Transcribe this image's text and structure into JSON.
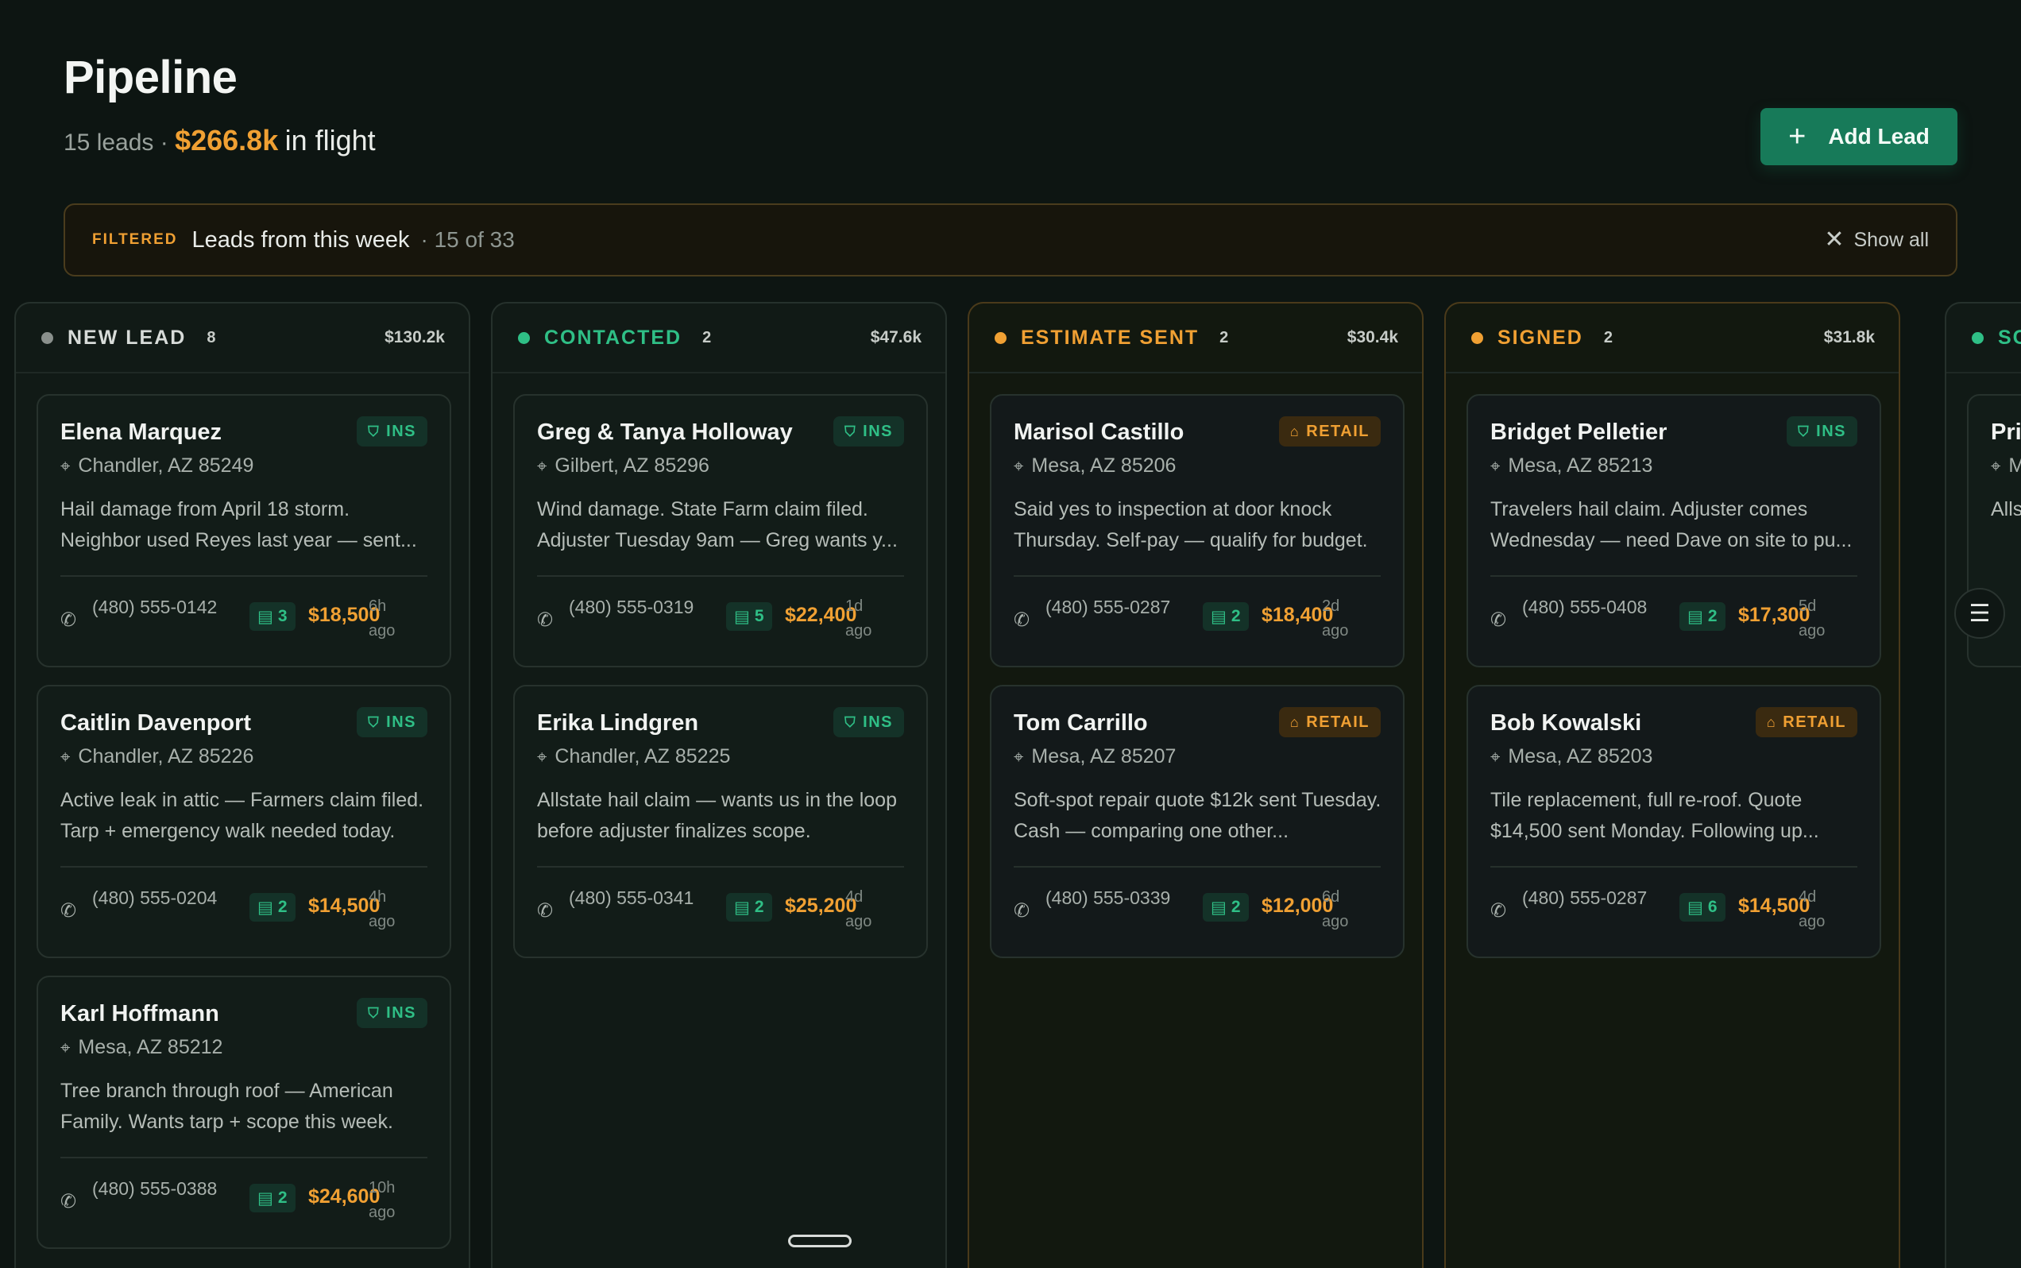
{
  "header": {
    "title": "Pipeline",
    "lead_count": "15 leads ·",
    "amount": "$266.8k",
    "amount_suffix": "in flight",
    "add_button": "Add Lead"
  },
  "filter": {
    "tag": "FILTERED",
    "label": "Leads from this week",
    "count": "· 15 of 33",
    "show_all": "Show all"
  },
  "colors": {
    "accent_green": "#177a59",
    "ins_green": "#2fbf86",
    "amber": "#f0a033",
    "new_lead_dot": "#8a908c"
  },
  "columns": [
    {
      "title": "NEW LEAD",
      "count": "8",
      "total": "$130.2k",
      "cards": [
        {
          "name": "Elena Marquez",
          "badge": "INS",
          "location": "Chandler, AZ 85249",
          "note": "Hail damage from April 18 storm. Neighbor used Reyes last year — sent...",
          "phone": "(480) 555-0142",
          "notes": "3",
          "price": "$18,500",
          "ago": "6h ago"
        },
        {
          "name": "Caitlin Davenport",
          "badge": "INS",
          "location": "Chandler, AZ 85226",
          "note": "Active leak in attic — Farmers claim filed. Tarp + emergency walk needed today.",
          "phone": "(480) 555-0204",
          "notes": "2",
          "price": "$14,500",
          "ago": "4h ago"
        },
        {
          "name": "Karl Hoffmann",
          "badge": "INS",
          "location": "Mesa, AZ 85212",
          "note": "Tree branch through roof — American Family. Wants tarp + scope this week.",
          "phone": "(480) 555-0388",
          "notes": "2",
          "price": "$24,600",
          "ago": "10h ago"
        }
      ]
    },
    {
      "title": "CONTACTED",
      "count": "2",
      "total": "$47.6k",
      "cards": [
        {
          "name": "Greg & Tanya Holloway",
          "badge": "INS",
          "location": "Gilbert, AZ 85296",
          "note": "Wind damage. State Farm claim filed. Adjuster Tuesday 9am — Greg wants y...",
          "phone": "(480) 555-0319",
          "notes": "5",
          "price": "$22,400",
          "ago": "1d ago"
        },
        {
          "name": "Erika Lindgren",
          "badge": "INS",
          "location": "Chandler, AZ 85225",
          "note": "Allstate hail claim — wants us in the loop before adjuster finalizes scope.",
          "phone": "(480) 555-0341",
          "notes": "2",
          "price": "$25,200",
          "ago": "4d ago"
        }
      ]
    },
    {
      "title": "ESTIMATE SENT",
      "count": "2",
      "total": "$30.4k",
      "cards": [
        {
          "name": "Marisol Castillo",
          "badge": "RETAIL",
          "location": "Mesa, AZ 85206",
          "note": "Said yes to inspection at door knock Thursday. Self-pay — qualify for budget.",
          "phone": "(480) 555-0287",
          "notes": "2",
          "price": "$18,400",
          "ago": "2d ago"
        },
        {
          "name": "Tom Carrillo",
          "badge": "RETAIL",
          "location": "Mesa, AZ 85207",
          "note": "Soft-spot repair quote $12k sent Tuesday. Cash — comparing one other...",
          "phone": "(480) 555-0339",
          "notes": "2",
          "price": "$12,000",
          "ago": "6d ago"
        }
      ]
    },
    {
      "title": "SIGNED",
      "count": "2",
      "total": "$31.8k",
      "cards": [
        {
          "name": "Bridget Pelletier",
          "badge": "INS",
          "location": "Mesa, AZ 85213",
          "note": "Travelers hail claim. Adjuster comes Wednesday — need Dave on site to pu...",
          "phone": "(480) 555-0408",
          "notes": "2",
          "price": "$17,300",
          "ago": "5d ago"
        },
        {
          "name": "Bob Kowalski",
          "badge": "RETAIL",
          "location": "Mesa, AZ 85203",
          "note": "Tile replacement, full re-roof. Quote $14,500 sent Monday. Following up...",
          "phone": "(480) 555-0287",
          "notes": "6",
          "price": "$14,500",
          "ago": "4d ago"
        }
      ]
    },
    {
      "title": "SC",
      "count": "",
      "total": "",
      "cards": [
        {
          "name": "Pri",
          "badge": "",
          "location": "M",
          "note": "Alls sign",
          "phone": "",
          "notes": "",
          "price": "",
          "ago": ""
        }
      ]
    }
  ]
}
